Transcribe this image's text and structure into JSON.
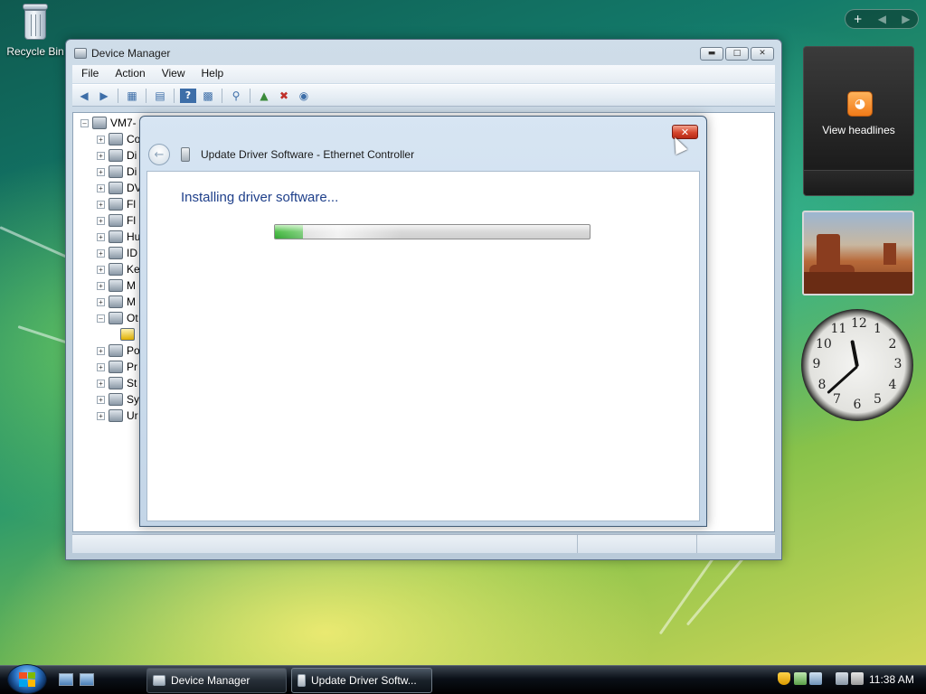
{
  "desktop": {
    "recycle_bin_label": "Recycle Bin"
  },
  "device_manager": {
    "title": "Device Manager",
    "menu": [
      "File",
      "Action",
      "View",
      "Help"
    ],
    "tree_root": "VM7-",
    "tree_items": [
      {
        "label": "Co",
        "expanded": false
      },
      {
        "label": "Di",
        "expanded": false
      },
      {
        "label": "Di",
        "expanded": false
      },
      {
        "label": "DV",
        "expanded": false
      },
      {
        "label": "Fl",
        "expanded": false
      },
      {
        "label": "Fl",
        "expanded": false
      },
      {
        "label": "Hu",
        "expanded": false
      },
      {
        "label": "ID",
        "expanded": false
      },
      {
        "label": "Ke",
        "expanded": false
      },
      {
        "label": "M",
        "expanded": false
      },
      {
        "label": "M",
        "expanded": false
      },
      {
        "label": "Ot",
        "expanded": true
      },
      {
        "label": "",
        "expanded": false
      },
      {
        "label": "Po",
        "expanded": false
      },
      {
        "label": "Pr",
        "expanded": false
      },
      {
        "label": "St",
        "expanded": false
      },
      {
        "label": "Sy",
        "expanded": false
      },
      {
        "label": "Ur",
        "expanded": false
      }
    ]
  },
  "update_dialog": {
    "title": "Update Driver Software - Ethernet Controller",
    "heading": "Installing driver software...",
    "progress_fraction": 0.09
  },
  "gadgets": {
    "feed_label": "View headlines",
    "clock_numbers": [
      "12",
      "1",
      "2",
      "3",
      "4",
      "5",
      "6",
      "7",
      "8",
      "9",
      "10",
      "11"
    ],
    "clock_time": "11:38"
  },
  "taskbar": {
    "buttons": [
      {
        "label": "Device Manager"
      },
      {
        "label": "Update Driver Softw..."
      }
    ],
    "clock": "11:38 AM"
  },
  "colors": {
    "dialog_heading": "#1e3f8a",
    "progress_green": "#4fbe4a",
    "close_red": "#d5452d"
  }
}
